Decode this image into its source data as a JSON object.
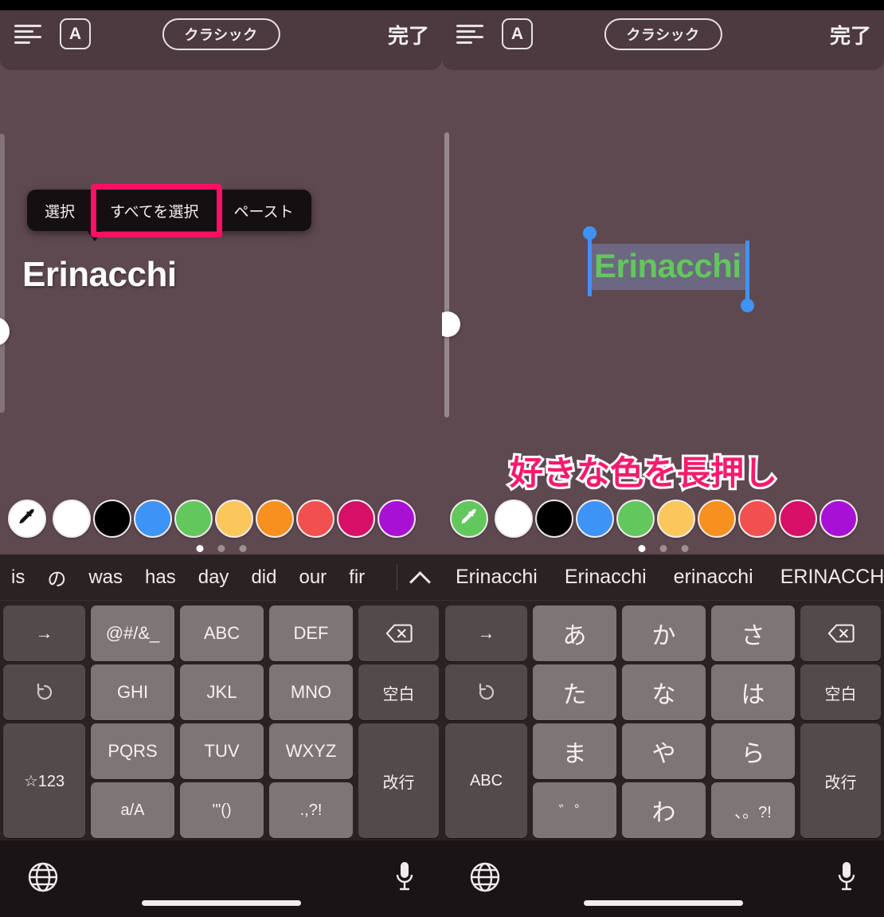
{
  "app": {
    "canvas_bg": "#5E4950",
    "toolbar_bg": "#4C3A40",
    "accent_pink": "#FF1064",
    "selection_green": "#62C75C",
    "handle_blue": "#3E93F7"
  },
  "toolbar": {
    "align_icon": "text-align-left-icon",
    "font_icon": "A",
    "style_label": "クラシック",
    "done_label": "完了"
  },
  "canvas": {
    "left_text": "Erinacchi",
    "right_text": "Erinacchi"
  },
  "context_menu": {
    "items": [
      {
        "label": "選択"
      },
      {
        "label": "すべてを選択"
      },
      {
        "label": "ペースト"
      }
    ],
    "highlighted_index": 1
  },
  "annotation": {
    "text": "好きな色を長押し"
  },
  "palette": {
    "left": {
      "eyedropper_fill": "#ffffff",
      "eyedropper_name": "eyedropper-icon",
      "swatches": [
        {
          "name": "white",
          "color": "#FFFFFF"
        },
        {
          "name": "black",
          "color": "#000000"
        },
        {
          "name": "blue",
          "color": "#3E93F7"
        },
        {
          "name": "green",
          "color": "#62C75C"
        },
        {
          "name": "yellow",
          "color": "#FBC košice"
        },
        {
          "name": "orange",
          "color": "#F7901E"
        },
        {
          "name": "red",
          "color": "#F2504F"
        },
        {
          "name": "magenta",
          "color": "#D60F67"
        },
        {
          "name": "purple",
          "color": "#A910D6"
        }
      ],
      "dots": [
        true,
        false,
        false
      ]
    },
    "right": {
      "eyedropper_fill": "#62C75C",
      "eyedropper_name": "eyedropper-icon",
      "dots": [
        true,
        false,
        false
      ]
    },
    "swatch_colors": [
      "#FFFFFF",
      "#000000",
      "#3E93F7",
      "#62C75C",
      "#FBC75A",
      "#F7901E",
      "#F2504F",
      "#D60F67",
      "#A910D6"
    ],
    "swatch_names": [
      "white",
      "black",
      "blue",
      "green",
      "yellow",
      "orange",
      "red",
      "magenta",
      "purple"
    ]
  },
  "keyboard_left": {
    "suggestions": [
      "is",
      "の",
      "was",
      "has",
      "day",
      "did",
      "our",
      "fir"
    ],
    "expand_icon": "chevron-up-icon",
    "keys": [
      {
        "label": "→",
        "style": "dark",
        "name": "cursor-right-key"
      },
      {
        "label": "@#/&_",
        "style": "light",
        "name": "symbols-key"
      },
      {
        "label": "ABC",
        "style": "light",
        "name": "abc-key"
      },
      {
        "label": "DEF",
        "style": "light",
        "name": "def-key"
      },
      {
        "label": "⌫",
        "style": "dark",
        "name": "backspace-key"
      },
      {
        "label": "↺",
        "style": "dark",
        "name": "undo-key"
      },
      {
        "label": "GHI",
        "style": "light",
        "name": "ghi-key"
      },
      {
        "label": "JKL",
        "style": "light",
        "name": "jkl-key"
      },
      {
        "label": "MNO",
        "style": "light",
        "name": "mno-key"
      },
      {
        "label": "空白",
        "style": "dark",
        "name": "space-key"
      },
      {
        "label": "☆123",
        "style": "dark",
        "name": "numbers-key"
      },
      {
        "label": "PQRS",
        "style": "light",
        "name": "pqrs-key"
      },
      {
        "label": "TUV",
        "style": "light",
        "name": "tuv-key"
      },
      {
        "label": "WXYZ",
        "style": "light",
        "name": "wxyz-key"
      },
      {
        "label": "改行",
        "style": "dark",
        "name": "return-key"
      },
      {
        "label": "a/A",
        "style": "light",
        "name": "case-key"
      },
      {
        "label": "'\"()",
        "style": "light",
        "name": "brackets-key"
      },
      {
        "label": ".,?!",
        "style": "light",
        "name": "punctuation-key"
      }
    ]
  },
  "keyboard_right": {
    "suggestions": [
      "Erinacchi",
      "Erinacchi",
      "erinacchi",
      "ERINACCHI"
    ],
    "keys": [
      {
        "label": "→",
        "style": "dark",
        "name": "cursor-right-key"
      },
      {
        "label": "あ",
        "style": "light",
        "name": "a-row-key"
      },
      {
        "label": "か",
        "style": "light",
        "name": "ka-row-key"
      },
      {
        "label": "さ",
        "style": "light",
        "name": "sa-row-key"
      },
      {
        "label": "⌫",
        "style": "dark",
        "name": "backspace-key"
      },
      {
        "label": "↺",
        "style": "dark",
        "name": "undo-key"
      },
      {
        "label": "た",
        "style": "light",
        "name": "ta-row-key"
      },
      {
        "label": "な",
        "style": "light",
        "name": "na-row-key"
      },
      {
        "label": "は",
        "style": "light",
        "name": "ha-row-key"
      },
      {
        "label": "空白",
        "style": "dark",
        "name": "space-key"
      },
      {
        "label": "ABC",
        "style": "dark",
        "name": "abc-mode-key"
      },
      {
        "label": "ま",
        "style": "light",
        "name": "ma-row-key"
      },
      {
        "label": "や",
        "style": "light",
        "name": "ya-row-key"
      },
      {
        "label": "ら",
        "style": "light",
        "name": "ra-row-key"
      },
      {
        "label": "改行",
        "style": "dark",
        "name": "return-key"
      },
      {
        "label": "゛゜",
        "style": "light",
        "name": "dakuten-key"
      },
      {
        "label": "わ",
        "style": "light",
        "name": "wa-row-key"
      },
      {
        "label": "、。?!",
        "style": "light",
        "name": "punctuation-key"
      }
    ]
  },
  "kb_bottom": {
    "globe_icon": "globe-icon",
    "mic_icon": "microphone-icon"
  }
}
